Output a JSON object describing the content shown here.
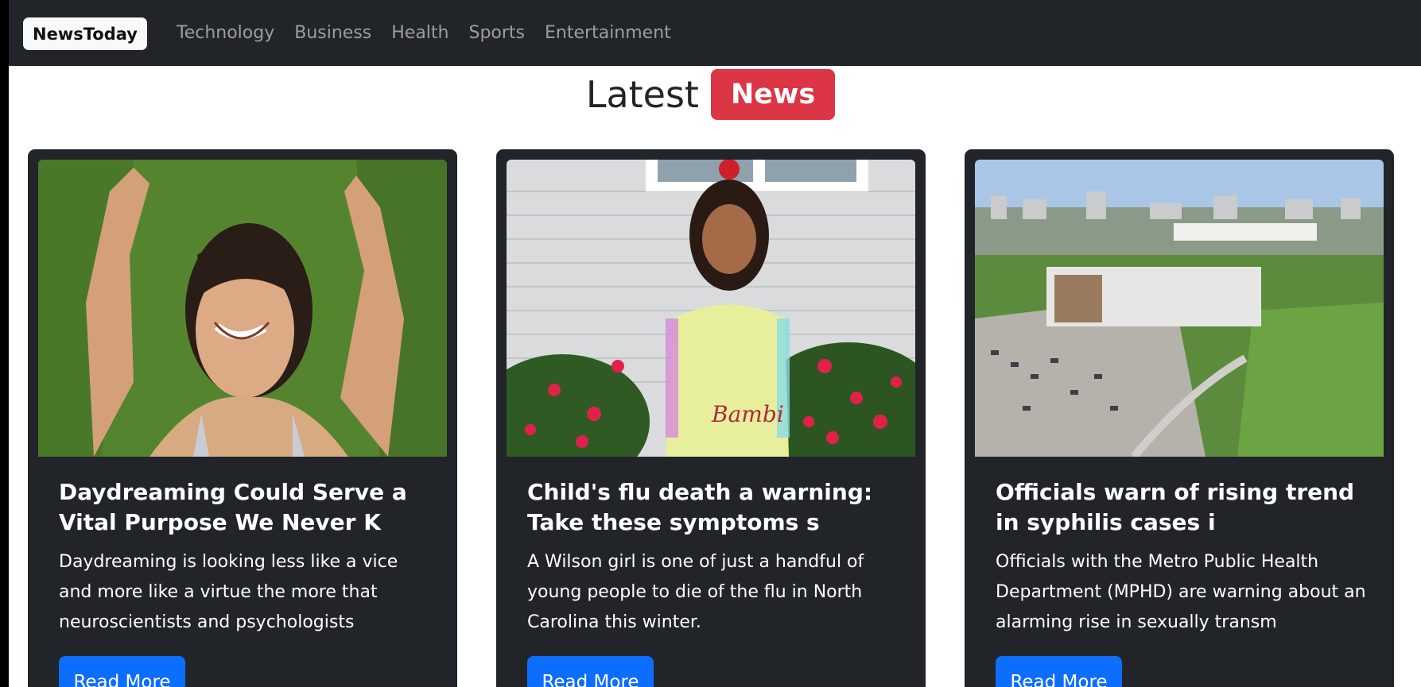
{
  "navbar": {
    "brand": "NewsToday",
    "links": [
      "Technology",
      "Business",
      "Health",
      "Sports",
      "Entertainment"
    ]
  },
  "heading": {
    "text": "Latest",
    "badge": "News",
    "badge_color": "#dc3545"
  },
  "articles": [
    {
      "title": "Daydreaming Could Serve a Vital Purpose We Never K",
      "description": "Daydreaming is looking less like a vice and more like a virtue the more that neuroscientists and psychologists",
      "button": "Read More"
    },
    {
      "title": "Child's flu death a warning: Take these symptoms s",
      "description": "A Wilson girl is one of just a handful of young people to die of the flu in North Carolina this winter.",
      "button": "Read More"
    },
    {
      "title": "Officials warn of rising trend in syphilis cases i",
      "description": "Officials with the Metro Public Health Department (MPHD) are warning about an alarming rise in sexually transm",
      "button": "Read More"
    }
  ],
  "colors": {
    "navbar_bg": "#212529",
    "card_bg": "#212529",
    "button_bg": "#0d6efd"
  }
}
